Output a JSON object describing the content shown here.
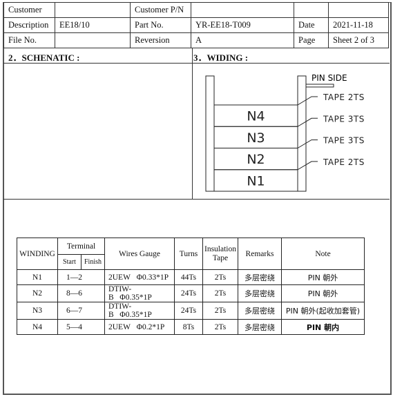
{
  "header": {
    "rows": [
      [
        {
          "label": "Customer",
          "value": ""
        },
        {
          "label": "Customer P/N",
          "value": ""
        },
        {
          "label": "",
          "value": ""
        }
      ],
      [
        {
          "label": "Description",
          "value": "EE18/10"
        },
        {
          "label": "Part No.",
          "value": "YR-EE18-T009"
        },
        {
          "label": "Date",
          "value": "2021-11-18"
        }
      ],
      [
        {
          "label": "File No.",
          "value": ""
        },
        {
          "label": "Reversion",
          "value": "A"
        },
        {
          "label": "Page",
          "value": "Sheet 2 of 3"
        }
      ]
    ]
  },
  "sections": {
    "schematic_title": "2．SCHENATIC :",
    "winding_title": "3．WIDING :"
  },
  "winding_diagram": {
    "pin_side_label": "PIN SIDE",
    "layers_top_to_bottom": [
      "N4",
      "N3",
      "N2",
      "N1"
    ],
    "tape_labels_top_to_bottom": [
      "TAPE 2TS",
      "TAPE 3TS",
      "TAPE 3TS",
      "TAPE 2TS"
    ]
  },
  "winding_table": {
    "headers": {
      "winding": "WINDING",
      "terminal": "Terminal",
      "start": "Start",
      "finish": "Finish",
      "wires_gauge": "Wires Gauge",
      "turns": "Turns",
      "insulation_tape": "Insulation Tape",
      "remarks": "Remarks",
      "note": "Note"
    },
    "rows": [
      {
        "winding": "N1",
        "terminal": "1—2",
        "wire_type": "2UEW",
        "wire_size": "Φ0.33*1P",
        "turns": "44Ts",
        "tape": "2Ts",
        "remarks": "多层密绕",
        "note": "PIN 朝外",
        "note_bold": false
      },
      {
        "winding": "N2",
        "terminal": "8—6",
        "wire_type": "DTIW-B",
        "wire_size": "Φ0.35*1P",
        "turns": "24Ts",
        "tape": "2Ts",
        "remarks": "多层密绕",
        "note": "PIN 朝外",
        "note_bold": false
      },
      {
        "winding": "N3",
        "terminal": "6—7",
        "wire_type": "DTIW-B",
        "wire_size": "Φ0.35*1P",
        "turns": "24Ts",
        "tape": "2Ts",
        "remarks": "多层密绕",
        "note": "PIN 朝外(起收加套管)",
        "note_bold": false
      },
      {
        "winding": "N4",
        "terminal": "5—4",
        "wire_type": "2UEW",
        "wire_size": "Φ0.2*1P",
        "turns": "8Ts",
        "tape": "2Ts",
        "remarks": "多层密绕",
        "note": "PIN 朝内",
        "note_bold": true
      }
    ]
  }
}
